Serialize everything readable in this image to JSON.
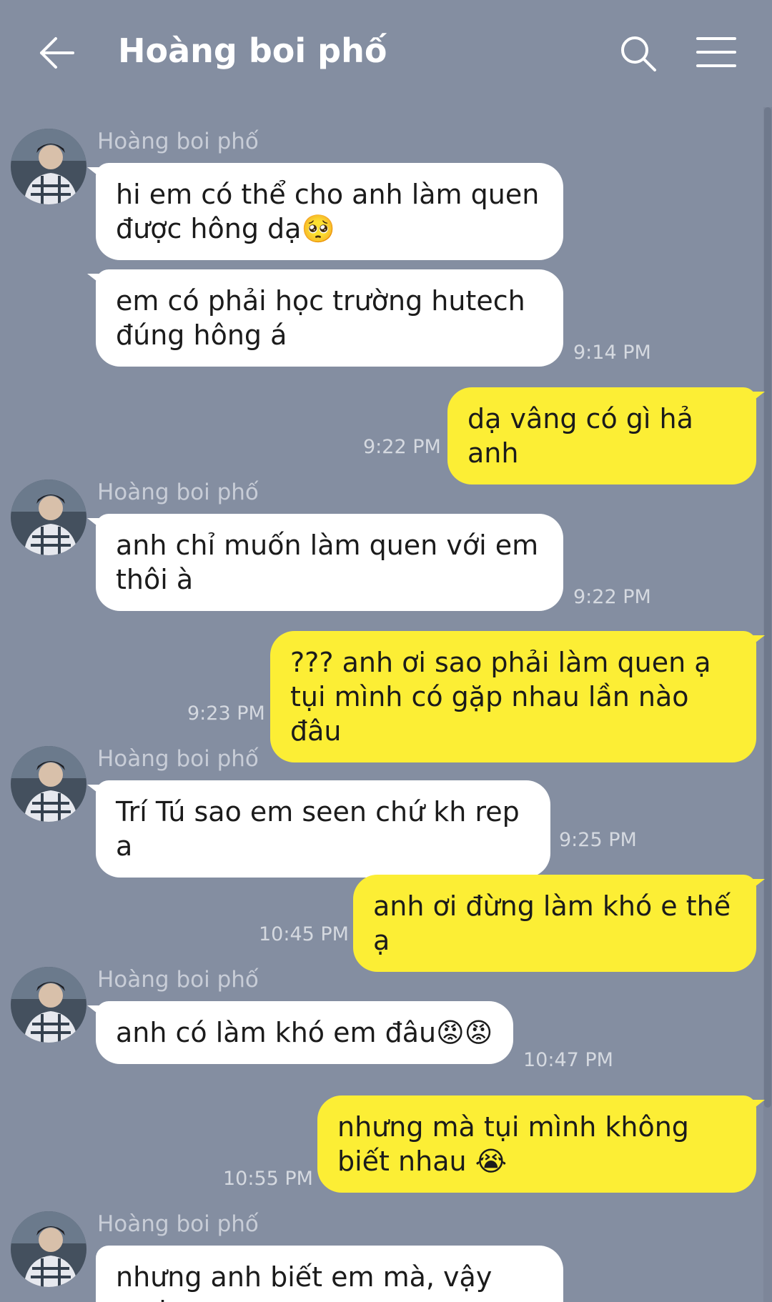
{
  "header": {
    "title": "Hoàng boi phố",
    "back_icon": "arrow-left-icon",
    "search_icon": "search-icon",
    "menu_icon": "hamburger-menu-icon"
  },
  "colors": {
    "background": "#848ea1",
    "incoming_bubble": "#ffffff",
    "outgoing_bubble": "#fcee35",
    "text": "#1b1b1b",
    "timestamp": "#d5d9e0"
  },
  "messages": [
    {
      "sender": "Hoàng boi phố",
      "text": "hi em có thể cho anh làm quen được hông dạ🥺"
    },
    {
      "text": "em có phải học trường hutech đúng hông á",
      "time": "9:14 PM"
    },
    {
      "text": "dạ vâng có gì hả anh",
      "time": "9:22 PM"
    },
    {
      "sender": "Hoàng boi phố",
      "text": "anh chỉ muốn làm quen với em thôi à",
      "time": "9:22 PM"
    },
    {
      "text": "??? anh ơi sao phải làm quen ạ tụi mình có gặp nhau lần nào đâu",
      "time": "9:23 PM"
    },
    {
      "sender": "Hoàng boi phố",
      "text": "Trí Tú sao em seen chứ kh rep a",
      "time": "9:25 PM"
    },
    {
      "text": "anh ơi đừng làm khó e thế ạ",
      "time": "10:45 PM"
    },
    {
      "sender": "Hoàng boi phố",
      "text": "anh có làm khó em đâu😡😡",
      "time": "10:47 PM"
    },
    {
      "text": "nhưng mà tụi mình không biết nhau 😭",
      "time": "10:55 PM"
    },
    {
      "sender": "Hoàng boi phố",
      "text": "nhưng anh biết em mà, vậy mai"
    }
  ]
}
